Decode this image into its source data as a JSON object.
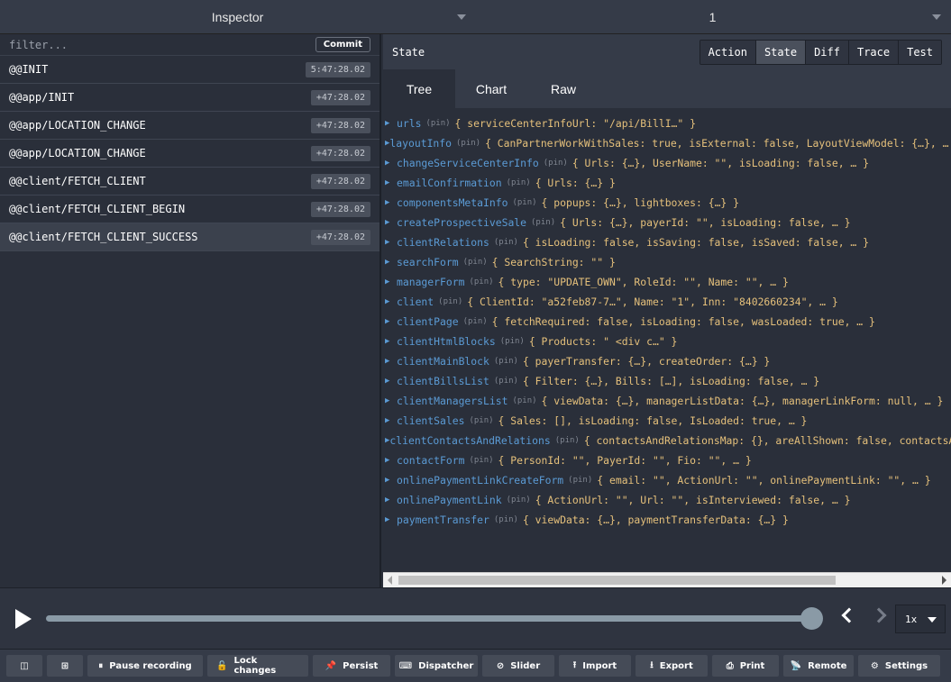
{
  "topbar": {
    "left_select": "Inspector",
    "right_select": "1"
  },
  "filter": {
    "placeholder": "filter...",
    "commit_label": "Commit"
  },
  "actions": [
    {
      "name": "@@INIT",
      "time": "5:47:28.02"
    },
    {
      "name": "@@app/INIT",
      "time": "+47:28.02"
    },
    {
      "name": "@@app/LOCATION_CHANGE",
      "time": "+47:28.02"
    },
    {
      "name": "@@app/LOCATION_CHANGE",
      "time": "+47:28.02"
    },
    {
      "name": "@@client/FETCH_CLIENT",
      "time": "+47:28.02"
    },
    {
      "name": "@@client/FETCH_CLIENT_BEGIN",
      "time": "+47:28.02"
    },
    {
      "name": "@@client/FETCH_CLIENT_SUCCESS",
      "time": "+47:28.02"
    }
  ],
  "selected_action_index": 6,
  "state_panel": {
    "title": "State",
    "buttons": [
      "Action",
      "State",
      "Diff",
      "Trace",
      "Test"
    ],
    "active_button": "State",
    "tabs": [
      "Tree",
      "Chart",
      "Raw"
    ],
    "active_tab": "Tree",
    "pin_label": "(pin)"
  },
  "tree": [
    {
      "key": "urls",
      "value": "{ serviceCenterInfoUrl: \"/api/BillI…\" }"
    },
    {
      "key": "layoutInfo",
      "value": "{ CanPartnerWorkWithSales: true, isExternal: false, LayoutViewModel: {…}, … }"
    },
    {
      "key": "changeServiceCenterInfo",
      "value": "{ Urls: {…}, UserName: \"\", isLoading: false, … }"
    },
    {
      "key": "emailConfirmation",
      "value": "{ Urls: {…} }"
    },
    {
      "key": "componentsMetaInfo",
      "value": "{ popups: {…}, lightboxes: {…} }"
    },
    {
      "key": "createProspectiveSale",
      "value": "{ Urls: {…}, payerId: \"\", isLoading: false, … }"
    },
    {
      "key": "clientRelations",
      "value": "{ isLoading: false, isSaving: false, isSaved: false, … }"
    },
    {
      "key": "searchForm",
      "value": "{ SearchString: \"\" }"
    },
    {
      "key": "managerForm",
      "value": "{ type: \"UPDATE_OWN\", RoleId: \"\", Name: \"\", … }"
    },
    {
      "key": "client",
      "value": "{ ClientId: \"a52feb87-7…\", Name: \"1\", Inn: \"8402660234\", … }"
    },
    {
      "key": "clientPage",
      "value": "{ fetchRequired: false, isLoading: false, wasLoaded: true, … }"
    },
    {
      "key": "clientHtmlBlocks",
      "value": "{ Products: \" <div c…\" }"
    },
    {
      "key": "clientMainBlock",
      "value": "{ payerTransfer: {…}, createOrder: {…} }"
    },
    {
      "key": "clientBillsList",
      "value": "{ Filter: {…}, Bills: […], isLoading: false, … }"
    },
    {
      "key": "clientManagersList",
      "value": "{ viewData: {…}, managerListData: {…}, managerLinkForm: null, … }"
    },
    {
      "key": "clientSales",
      "value": "{ Sales: [], isLoading: false, IsLoaded: true, … }"
    },
    {
      "key": "clientContactsAndRelations",
      "value": "{ contactsAndRelationsMap: {}, areAllShown: false, contactsAn"
    },
    {
      "key": "contactForm",
      "value": "{ PersonId: \"\", PayerId: \"\", Fio: \"\", … }"
    },
    {
      "key": "onlinePaymentLinkCreateForm",
      "value": "{ email: \"\", ActionUrl: \"\", onlinePaymentLink: \"\", … }"
    },
    {
      "key": "onlinePaymentLink",
      "value": "{ ActionUrl: \"\", Url: \"\", isInterviewed: false, … }"
    },
    {
      "key": "paymentTransfer",
      "value": "{ viewData: {…}, paymentTransferData: {…} }"
    }
  ],
  "player": {
    "speed": "1x",
    "slider_position": 1.0
  },
  "toolbar": [
    {
      "icon": "layout-1-icon",
      "glyph": "◫",
      "label": ""
    },
    {
      "icon": "layout-2-icon",
      "glyph": "⊞",
      "label": ""
    },
    {
      "icon": "pause-icon",
      "glyph": "⏸",
      "label": "Pause recording"
    },
    {
      "icon": "lock-icon",
      "glyph": "🔓",
      "label": "Lock changes"
    },
    {
      "icon": "pin-icon",
      "glyph": "📌",
      "label": "Persist"
    },
    {
      "icon": "keyboard-icon",
      "glyph": "⌨",
      "label": "Dispatcher"
    },
    {
      "icon": "slider-icon",
      "glyph": "⊘",
      "label": "Slider"
    },
    {
      "icon": "upload-icon",
      "glyph": "⭱",
      "label": "Import"
    },
    {
      "icon": "download-icon",
      "glyph": "⭳",
      "label": "Export"
    },
    {
      "icon": "print-icon",
      "glyph": "⎙",
      "label": "Print"
    },
    {
      "icon": "remote-icon",
      "glyph": "📡",
      "label": "Remote"
    },
    {
      "icon": "gear-icon",
      "glyph": "⚙",
      "label": "Settings"
    }
  ]
}
